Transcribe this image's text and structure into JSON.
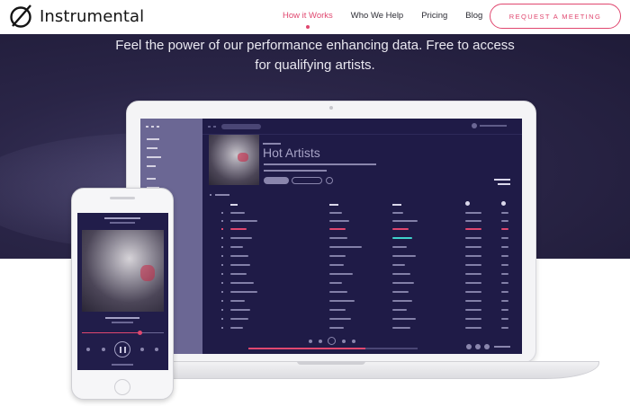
{
  "brand": {
    "name": "Instrumental",
    "logo_icon": "slashed-circle-icon"
  },
  "nav": {
    "items": [
      {
        "label": "How it Works",
        "active": true
      },
      {
        "label": "Who We Help",
        "active": false
      },
      {
        "label": "Pricing",
        "active": false
      },
      {
        "label": "Blog",
        "active": false
      }
    ],
    "cta_label": "REQUEST A MEETING"
  },
  "hero": {
    "line1": "Feel the power of our performance enhancing data. Free to access",
    "line2": "for qualifying artists."
  },
  "laptop_app": {
    "playlist_title": "Hot Artists"
  },
  "colors": {
    "accent": "#e0476f",
    "hero_bg": "#2a2547",
    "app_bg": "#1f1b47",
    "app_sidebar": "#6b6794",
    "highlight_teal": "#3fd2cc"
  }
}
